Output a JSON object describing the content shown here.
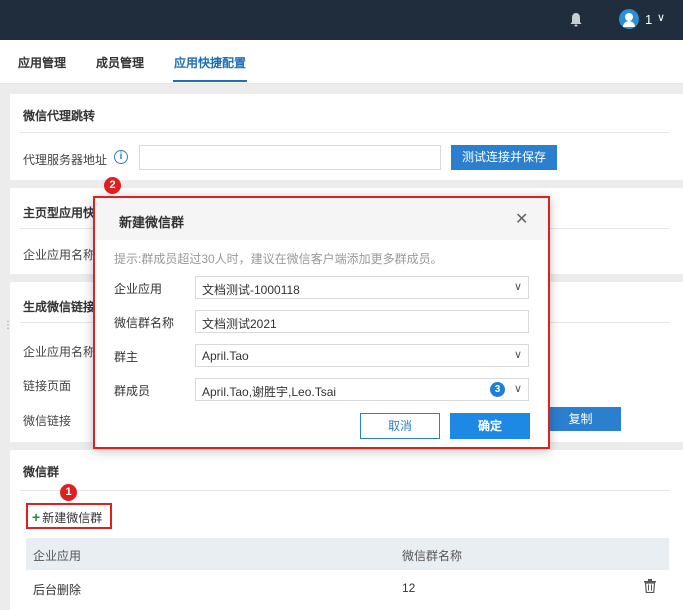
{
  "header": {
    "user_count": "1",
    "icons": {
      "bell": "bell-icon",
      "avatar": "user-avatar-icon",
      "chevron": "chevron-down-icon"
    }
  },
  "tabs": [
    {
      "label": "应用管理",
      "active": false
    },
    {
      "label": "成员管理",
      "active": false
    },
    {
      "label": "应用快捷配置",
      "active": true
    }
  ],
  "proxy": {
    "title": "微信代理跳转",
    "server_label": "代理服务器地址",
    "server_value": "",
    "test_button": "测试连接并保存"
  },
  "homepage": {
    "title": "主页型应用快",
    "app_name_label": "企业应用名称"
  },
  "link_gen": {
    "title": "生成微信链接",
    "app_name_label": "企业应用名称",
    "page_label": "链接页面",
    "link_label": "微信链接",
    "copy_button": "复制"
  },
  "wechat_group": {
    "title": "微信群",
    "new_button": "新建微信群",
    "columns": [
      "企业应用",
      "微信群名称"
    ],
    "rows": [
      {
        "app": "后台删除",
        "name": "12"
      }
    ]
  },
  "callouts": {
    "one": "1",
    "two": "2",
    "three": "3"
  },
  "dialog": {
    "title": "新建微信群",
    "hint": "提示:群成员超过30人时，建议在微信客户端添加更多群成员。",
    "fields": {
      "app_label": "企业应用",
      "app_value": "文档测试-1000118",
      "name_label": "微信群名称",
      "name_value": "文档测试2021",
      "owner_label": "群主",
      "owner_value": "April.Tao",
      "members_label": "群成员",
      "members_value": "April.Tao,谢胜宇,Leo.Tsai"
    },
    "cancel": "取消",
    "ok": "确定"
  },
  "colors": {
    "accent": "#2b7fcf",
    "highlight": "#e02020",
    "topbar": "#1f2d3d"
  }
}
